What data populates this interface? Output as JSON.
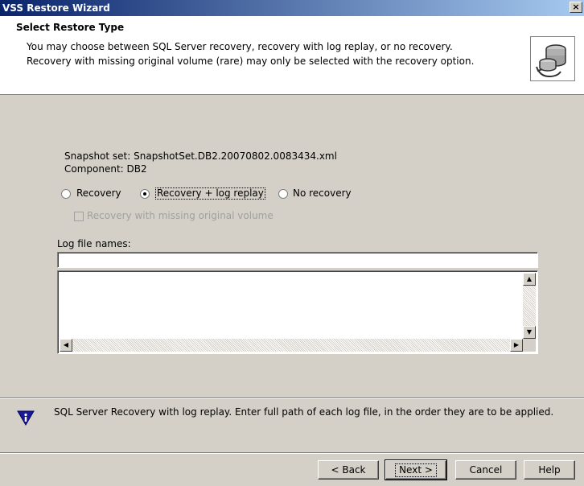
{
  "window": {
    "title": "VSS Restore Wizard",
    "close_glyph": "×"
  },
  "header": {
    "title": "Select Restore Type",
    "description_line1": "You may choose between SQL Server recovery, recovery with log replay, or no recovery.",
    "description_line2": "Recovery with missing original volume (rare) may only be selected with the recovery option.",
    "icon": "database-restore-icon"
  },
  "main": {
    "snapshot_set_label": "Snapshot set:",
    "snapshot_set_value": "SnapshotSet.DB2.20070802.0083434.xml",
    "component_label": "Component:",
    "component_value": "DB2",
    "restore_options": [
      {
        "label": "Recovery",
        "selected": false
      },
      {
        "label": "Recovery + log replay",
        "selected": true
      },
      {
        "label": "No recovery",
        "selected": false
      }
    ],
    "missing_volume_checkbox": {
      "label": "Recovery with missing original volume",
      "checked": false,
      "enabled": false
    },
    "log_file_names_label": "Log file names:",
    "log_file_names_value": ""
  },
  "info": {
    "icon": "info-shield-icon",
    "message": "SQL Server Recovery with log replay.  Enter full path of each log file, in the order they are to be applied."
  },
  "buttons": {
    "back": "< Back",
    "next": "Next >",
    "cancel": "Cancel",
    "help": "Help"
  },
  "colors": {
    "titlebar_start": "#0a246a",
    "titlebar_end": "#a6caf0",
    "dialog_face": "#d4d0c8",
    "info_icon": "#1a1a99"
  }
}
